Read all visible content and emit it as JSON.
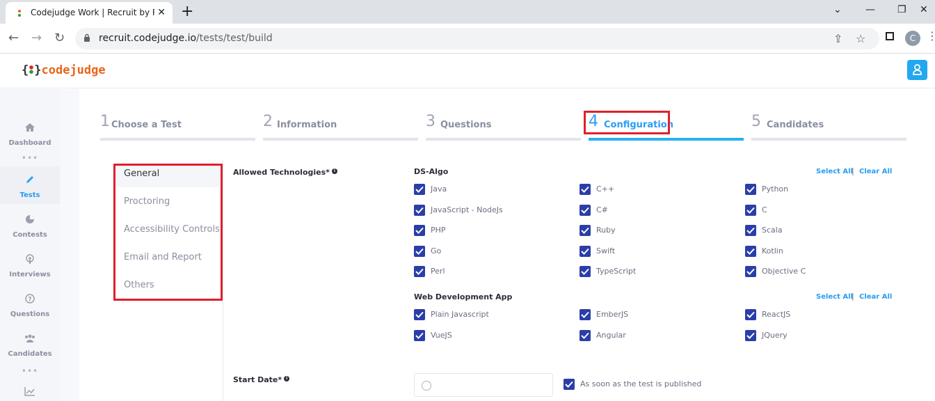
{
  "browser": {
    "tab_title": "Codejudge Work | Recruit by Rea",
    "tab_close": "✕",
    "new_tab": "+",
    "url_domain": "recruit.codejudge.io",
    "url_path": "/tests/test/build",
    "profile_initial": "C"
  },
  "app": {
    "logo_left_brace": "{",
    "logo_right_brace": "}",
    "logo_word": "codejudge"
  },
  "sidebar": {
    "items": [
      {
        "label": "Dashboard",
        "icon": "home-icon"
      },
      {
        "label": "Tests",
        "icon": "pen-icon"
      },
      {
        "label": "Contests",
        "icon": "pie-chart-icon"
      },
      {
        "label": "Interviews",
        "icon": "podcast-icon"
      },
      {
        "label": "Questions",
        "icon": "question-circle-icon"
      },
      {
        "label": "Candidates",
        "icon": "users-icon"
      }
    ],
    "dots": "•••"
  },
  "stepper": {
    "steps": [
      {
        "num": "1",
        "label": "Choose a Test"
      },
      {
        "num": "2",
        "label": "Information"
      },
      {
        "num": "3",
        "label": "Questions"
      },
      {
        "num": "4",
        "label": "Configuration"
      },
      {
        "num": "5",
        "label": "Candidates"
      }
    ],
    "active_index": 3
  },
  "settings_nav": {
    "items": [
      "General",
      "Proctoring",
      "Accessibility Controls",
      "Email and Report",
      "Others"
    ],
    "active": "General"
  },
  "form": {
    "allowed_tech_label": "Allowed Technologies*",
    "start_date_label": "Start Date*",
    "start_date_checkbox": "As soon as the test is published",
    "select_all": "Select All",
    "clear_all": "Clear All",
    "separator": "|",
    "groups": [
      {
        "title": "DS-Algo",
        "items": [
          "Java",
          "C++",
          "Python",
          "JavaScript - NodeJs",
          "C#",
          "C",
          "PHP",
          "Ruby",
          "Scala",
          "Go",
          "Swift",
          "Kotlin",
          "Perl",
          "TypeScript",
          "Objective C"
        ]
      },
      {
        "title": "Web Development App",
        "items": [
          "Plain Javascript",
          "EmberJS",
          "ReactJS",
          "VueJS",
          "Angular",
          "JQuery"
        ]
      }
    ]
  },
  "colors": {
    "accent": "#2a9df4",
    "checkbox": "#2b3ea8",
    "highlight_box": "#e0202c",
    "logo_orange": "#e8651a"
  }
}
